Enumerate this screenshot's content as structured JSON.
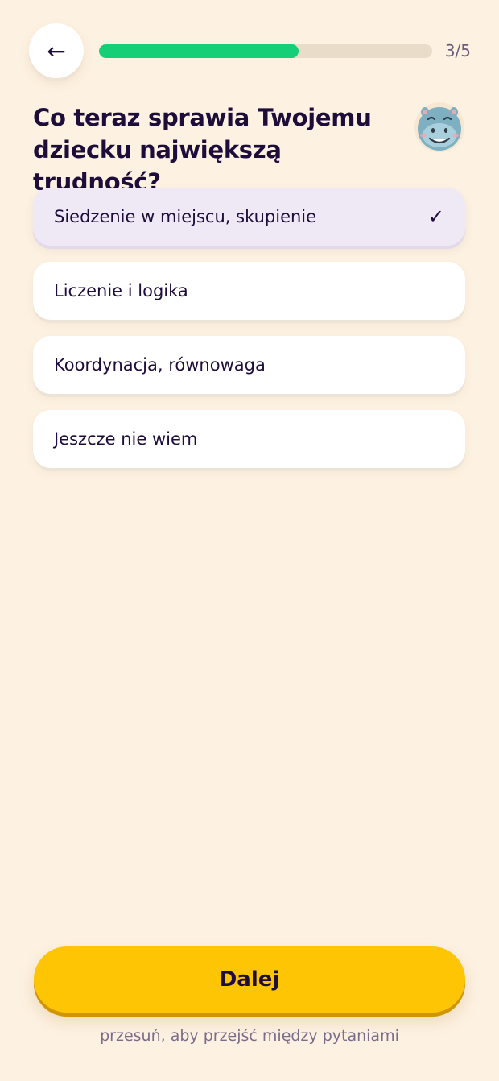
{
  "nav": {
    "back_glyph": "←",
    "back_icon": "arrow-left-icon"
  },
  "progress": {
    "current": 3,
    "total": 5,
    "fraction": 0.6,
    "label": "3/5",
    "fill_color": "#15cf76"
  },
  "question": {
    "text": "Co teraz sprawia Twojemu dziecku największą trudność?"
  },
  "mascot": {
    "icon": "hippo-mascot-icon"
  },
  "options": [
    {
      "label": "Siedzenie w miejscu, skupienie",
      "selected": true,
      "check_glyph": "✓"
    },
    {
      "label": "Liczenie i logika",
      "selected": false
    },
    {
      "label": "Koordynacja, równowaga",
      "selected": false
    },
    {
      "label": "Jeszcze nie wiem",
      "selected": false
    }
  ],
  "footer": {
    "next_label": "Dalej",
    "hint": "przesuń, aby przejść między pytaniami"
  },
  "colors": {
    "background": "#fdf1e1",
    "accent": "#fec505",
    "selected_option": "#efe9f5",
    "text": "#1e0c3a"
  }
}
